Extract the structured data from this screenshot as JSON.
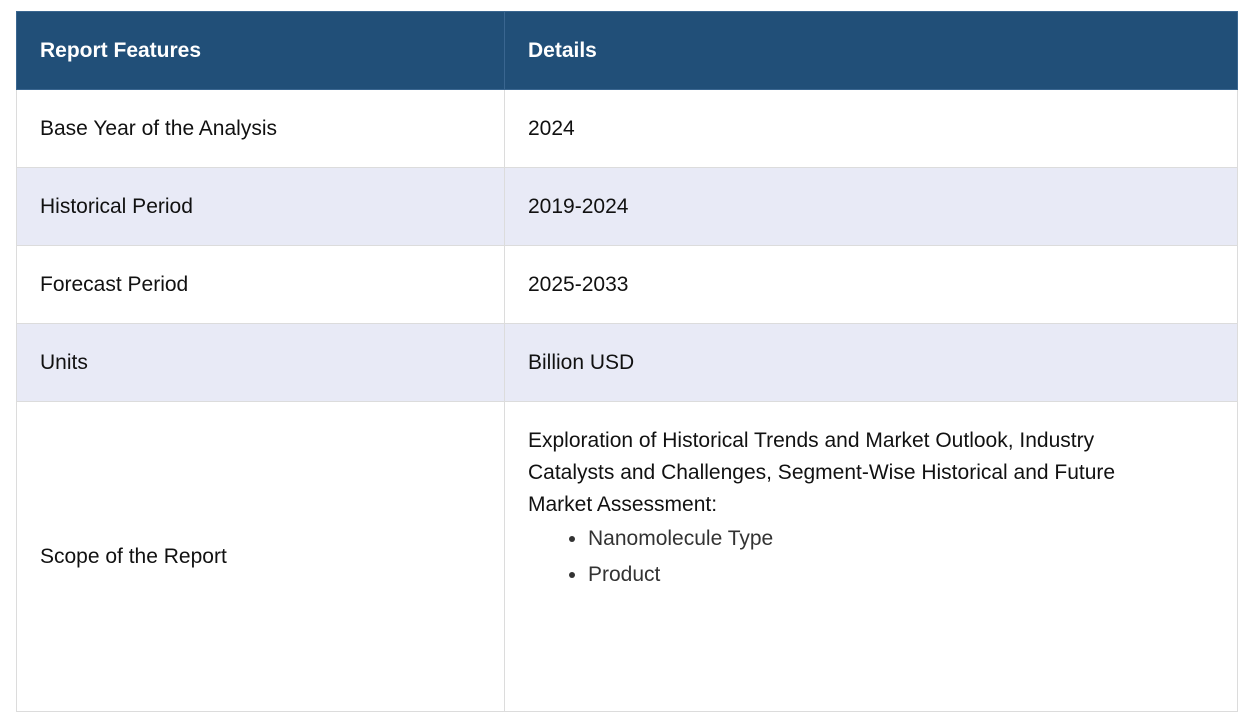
{
  "table": {
    "headers": [
      "Report Features",
      "Details"
    ],
    "rows": [
      {
        "feature": "Base Year of the Analysis",
        "detail": "2024"
      },
      {
        "feature": "Historical Period",
        "detail": "2019-2024"
      },
      {
        "feature": "Forecast Period",
        "detail": "2025-2033"
      },
      {
        "feature": "Units",
        "detail": "Billion USD"
      }
    ],
    "scope": {
      "feature": "Scope of the Report",
      "text": "Exploration of Historical Trends and Market Outlook, Industry Catalysts and Challenges, Segment-Wise Historical and Future Market Assessment:",
      "bullets": [
        "Nanomolecule Type",
        "Product"
      ]
    }
  },
  "colors": {
    "header_bg": "#214f78",
    "header_text": "#ffffff",
    "alt_row_bg": "#e8eaf6"
  }
}
